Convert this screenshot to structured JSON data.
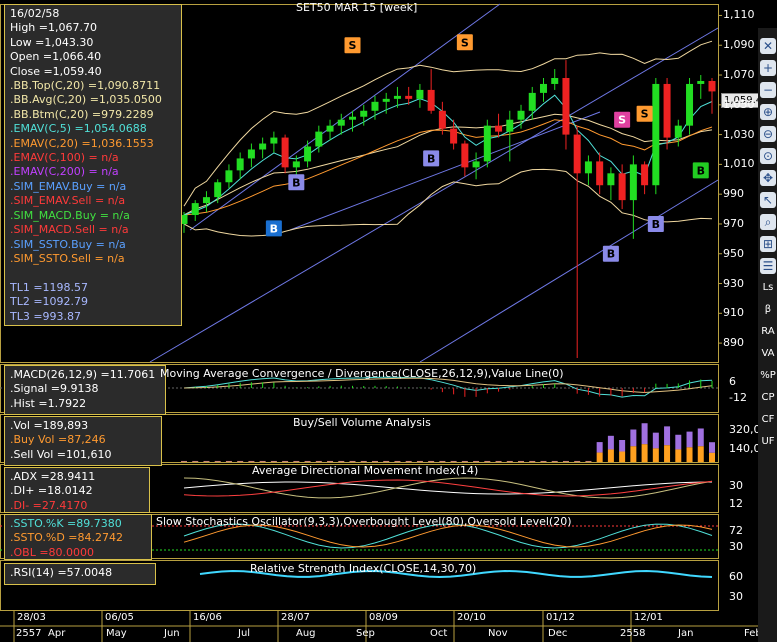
{
  "window": {
    "title": "SET50 MAR 15   [week]"
  },
  "info_main": [
    {
      "text": "16/02/58",
      "color": "#ffffff"
    },
    {
      "text": "High  =1,067.70",
      "color": "#ffffff"
    },
    {
      "text": "Low  =1,043.30",
      "color": "#ffffff"
    },
    {
      "text": "Open  =1,066.40",
      "color": "#ffffff"
    },
    {
      "text": "Close  =1,059.40",
      "color": "#ffffff"
    },
    {
      "text": ".BB.Top(C,20)  =1,090.8711",
      "color": "#f2e7a8"
    },
    {
      "text": ".BB.Avg(C,20)  =1,035.0500",
      "color": "#f2e7a8"
    },
    {
      "text": ".BB.Btm(C,20)  =979.2289",
      "color": "#f2e7a8"
    },
    {
      "text": ".EMAV(C,5)  =1,054.0688",
      "color": "#50e0d8"
    },
    {
      "text": ".EMAV(C,20)  =1,036.1553",
      "color": "#ff9a30"
    },
    {
      "text": ".EMAV(C,100)  = n/a",
      "color": "#ff3a3a"
    },
    {
      "text": ".EMAV(C,200)  = n/a",
      "color": "#c040ff"
    },
    {
      "text": ".SIM_EMAV.Buy  = n/a",
      "color": "#5aa0ff"
    },
    {
      "text": ".SIM_EMAV.Sell  = n/a",
      "color": "#ff3a3a"
    },
    {
      "text": ".SIM_MACD.Buy  = n/a",
      "color": "#40e040"
    },
    {
      "text": ".SIM_MACD.Sell  = n/a",
      "color": "#ff3a3a"
    },
    {
      "text": ".SIM_SSTO.Buy  = n/a",
      "color": "#5aa0ff"
    },
    {
      "text": ".SIM_SSTO.Sell  = n/a",
      "color": "#ff9a30"
    },
    {
      "text": "",
      "color": "#ffffff"
    },
    {
      "text": "TL1 =1198.57",
      "color": "#a8b8ff"
    },
    {
      "text": "TL2 =1092.79",
      "color": "#a8b8ff"
    },
    {
      "text": "TL3 =993.87",
      "color": "#a8b8ff"
    }
  ],
  "info_macd": [
    {
      "text": ".MACD(26,12,9)  =11.7061",
      "color": "#ffffff"
    },
    {
      "text": ".Signal  =9.9138",
      "color": "#ffffff"
    },
    {
      "text": ".Hist  =1.7922",
      "color": "#ffffff"
    }
  ],
  "info_vol": [
    {
      "text": ".Vol  =189,893",
      "color": "#ffffff"
    },
    {
      "text": ".Buy Vol  =87,246",
      "color": "#ff9a30"
    },
    {
      "text": ".Sell Vol  =101,610",
      "color": "#ffffff"
    }
  ],
  "info_adx": [
    {
      "text": ".ADX  =28.9411",
      "color": "#ffffff"
    },
    {
      "text": ".DI+  =18.0142",
      "color": "#ffffff"
    },
    {
      "text": ".DI-  =27.4170",
      "color": "#ff3a3a"
    }
  ],
  "info_ssto": [
    {
      "text": ".SSTO.%K  =89.7380",
      "color": "#50e0d8"
    },
    {
      "text": ".SSTO.%D  =84.2742",
      "color": "#ff9a30"
    },
    {
      "text": ".OBL  =80.0000",
      "color": "#ff3a3a"
    }
  ],
  "info_rsi": [
    {
      "text": ".RSI(14)  =57.0048",
      "color": "#ffffff"
    }
  ],
  "panel_titles": {
    "macd": "Moving Average Convergence / Divergence(CLOSE,26,12,9),Value Line(0)",
    "vol": "Buy/Sell Volume Analysis",
    "adx": "Average Directional Movement Index(14)",
    "ssto": "Slow Stochastics Oscillator(9,3,3),Overbought Level(80),Oversold Level(20)",
    "rsi": "Relative Strength Index(CLOSE,14,30,70)"
  },
  "last_price_label": "1,059.4",
  "toolbar": {
    "pin_icon": "pin-icon",
    "icons": [
      "close-icon",
      "plus-icon",
      "minus-icon",
      "zoom-in-icon",
      "zoom-out-icon",
      "zoom-fit-icon",
      "move-icon",
      "cursor-icon",
      "search-icon",
      "zoom-area-icon",
      "list-icon"
    ],
    "labels": [
      "Ls",
      "β",
      "RA",
      "VA",
      "%P",
      "CP",
      "CF",
      "UF"
    ]
  },
  "chart_data": [
    {
      "type": "candlestick",
      "title": "SET50 MAR 15   [week]",
      "y_ticks": [
        "1,110",
        "1,090",
        "1,070",
        "1,050",
        "1,030",
        "1,010",
        "990",
        "970",
        "950",
        "930",
        "910",
        "890"
      ],
      "ylim": [
        880,
        1115
      ],
      "x_top_labels": [
        "28/03",
        "06/05",
        "16/06",
        "28/07",
        "08/09",
        "20/10",
        "01/12",
        "12/01"
      ],
      "x_month_labels": [
        "2557",
        "Apr",
        "May",
        "Jun",
        "Jul",
        "Aug",
        "Sep",
        "Oct",
        "Nov",
        "Dec",
        "2558",
        "Jan",
        "Feb"
      ],
      "candles": [
        {
          "o": 970,
          "h": 978,
          "l": 964,
          "c": 976
        },
        {
          "o": 976,
          "h": 986,
          "l": 972,
          "c": 984
        },
        {
          "o": 984,
          "h": 992,
          "l": 978,
          "c": 988
        },
        {
          "o": 988,
          "h": 1000,
          "l": 984,
          "c": 998
        },
        {
          "o": 998,
          "h": 1010,
          "l": 994,
          "c": 1006
        },
        {
          "o": 1006,
          "h": 1018,
          "l": 1000,
          "c": 1014
        },
        {
          "o": 1014,
          "h": 1024,
          "l": 1008,
          "c": 1020
        },
        {
          "o": 1020,
          "h": 1028,
          "l": 1014,
          "c": 1024
        },
        {
          "o": 1024,
          "h": 1032,
          "l": 1018,
          "c": 1028
        },
        {
          "o": 1028,
          "h": 1030,
          "l": 1004,
          "c": 1008
        },
        {
          "o": 1008,
          "h": 1016,
          "l": 998,
          "c": 1012
        },
        {
          "o": 1012,
          "h": 1026,
          "l": 1008,
          "c": 1022
        },
        {
          "o": 1022,
          "h": 1036,
          "l": 1018,
          "c": 1032
        },
        {
          "o": 1032,
          "h": 1040,
          "l": 1026,
          "c": 1036
        },
        {
          "o": 1036,
          "h": 1044,
          "l": 1030,
          "c": 1040
        },
        {
          "o": 1040,
          "h": 1046,
          "l": 1032,
          "c": 1042
        },
        {
          "o": 1042,
          "h": 1050,
          "l": 1036,
          "c": 1046
        },
        {
          "o": 1046,
          "h": 1056,
          "l": 1040,
          "c": 1052
        },
        {
          "o": 1052,
          "h": 1058,
          "l": 1044,
          "c": 1054
        },
        {
          "o": 1054,
          "h": 1062,
          "l": 1048,
          "c": 1056
        },
        {
          "o": 1056,
          "h": 1062,
          "l": 1050,
          "c": 1054
        },
        {
          "o": 1054,
          "h": 1064,
          "l": 1048,
          "c": 1060
        },
        {
          "o": 1060,
          "h": 1074,
          "l": 1044,
          "c": 1046
        },
        {
          "o": 1046,
          "h": 1052,
          "l": 1030,
          "c": 1034
        },
        {
          "o": 1034,
          "h": 1040,
          "l": 1020,
          "c": 1024
        },
        {
          "o": 1024,
          "h": 1026,
          "l": 1002,
          "c": 1008
        },
        {
          "o": 1008,
          "h": 1018,
          "l": 1000,
          "c": 1012
        },
        {
          "o": 1012,
          "h": 1040,
          "l": 1008,
          "c": 1036
        },
        {
          "o": 1036,
          "h": 1044,
          "l": 1028,
          "c": 1032
        },
        {
          "o": 1032,
          "h": 1046,
          "l": 1012,
          "c": 1040
        },
        {
          "o": 1040,
          "h": 1050,
          "l": 1034,
          "c": 1046
        },
        {
          "o": 1046,
          "h": 1062,
          "l": 1040,
          "c": 1058
        },
        {
          "o": 1058,
          "h": 1068,
          "l": 1052,
          "c": 1064
        },
        {
          "o": 1064,
          "h": 1074,
          "l": 1060,
          "c": 1068
        },
        {
          "o": 1068,
          "h": 1080,
          "l": 1020,
          "c": 1030
        },
        {
          "o": 1030,
          "h": 1036,
          "l": 880,
          "c": 1004
        },
        {
          "o": 1004,
          "h": 1016,
          "l": 996,
          "c": 1012
        },
        {
          "o": 1012,
          "h": 1018,
          "l": 990,
          "c": 996
        },
        {
          "o": 996,
          "h": 1008,
          "l": 986,
          "c": 1004
        },
        {
          "o": 1004,
          "h": 1010,
          "l": 980,
          "c": 986
        },
        {
          "o": 986,
          "h": 1016,
          "l": 960,
          "c": 1010
        },
        {
          "o": 1010,
          "h": 1012,
          "l": 990,
          "c": 996
        },
        {
          "o": 996,
          "h": 1068,
          "l": 990,
          "c": 1064
        },
        {
          "o": 1064,
          "h": 1068,
          "l": 1020,
          "c": 1028
        },
        {
          "o": 1028,
          "h": 1040,
          "l": 1022,
          "c": 1036
        },
        {
          "o": 1036,
          "h": 1068,
          "l": 1030,
          "c": 1064
        },
        {
          "o": 1064,
          "h": 1070,
          "l": 1054,
          "c": 1066
        },
        {
          "o": 1066,
          "h": 1068,
          "l": 1044,
          "c": 1059
        }
      ],
      "signals": [
        {
          "label": "S",
          "i": 15,
          "price": 1090,
          "side": "sell"
        },
        {
          "label": "S",
          "i": 25,
          "price": 1092,
          "side": "sell"
        },
        {
          "label": "S",
          "i": 41,
          "price": 1044,
          "side": "sell"
        },
        {
          "label": "S",
          "i": 39,
          "price": 1040,
          "side": "sell2"
        },
        {
          "label": "B",
          "i": 8,
          "price": 967,
          "side": "buy2"
        },
        {
          "label": "B",
          "i": 10,
          "price": 998,
          "side": "buy"
        },
        {
          "label": "B",
          "i": 22,
          "price": 1014,
          "side": "buy"
        },
        {
          "label": "B",
          "i": 38,
          "price": 950,
          "side": "buy"
        },
        {
          "label": "B",
          "i": 42,
          "price": 970,
          "side": "buy"
        },
        {
          "label": "B",
          "i": 46,
          "price": 1006,
          "side": "buy3"
        }
      ]
    },
    {
      "type": "line",
      "title": "Moving Average Convergence / Divergence(CLOSE,26,12,9),Value Line(0)",
      "y_ticks": [
        "6",
        "-12"
      ]
    },
    {
      "type": "bar",
      "title": "Buy/Sell Volume Analysis",
      "y_ticks": [
        "320,0",
        "140,0"
      ],
      "ylim": [
        0,
        420000
      ],
      "buy": [
        5000,
        5000,
        5000,
        5000,
        5000,
        5000,
        5000,
        5000,
        5000,
        5000,
        5000,
        5000,
        5000,
        5000,
        5000,
        5000,
        5000,
        5000,
        5000,
        5000,
        5000,
        5000,
        5000,
        5000,
        5000,
        5000,
        5000,
        5000,
        5000,
        5000,
        5000,
        5000,
        5000,
        5000,
        5000,
        5000,
        5000,
        90000,
        120000,
        100000,
        150000,
        170000,
        130000,
        160000,
        120000,
        140000,
        150000,
        87246
      ],
      "sell": [
        5000,
        5000,
        5000,
        5000,
        5000,
        5000,
        5000,
        5000,
        5000,
        5000,
        5000,
        5000,
        5000,
        5000,
        5000,
        5000,
        5000,
        5000,
        5000,
        5000,
        5000,
        5000,
        5000,
        5000,
        5000,
        5000,
        5000,
        5000,
        5000,
        5000,
        5000,
        5000,
        5000,
        5000,
        5000,
        5000,
        5000,
        100000,
        130000,
        110000,
        160000,
        200000,
        150000,
        180000,
        140000,
        150000,
        170000,
        101610
      ]
    },
    {
      "type": "line",
      "title": "Average Directional Movement Index(14)",
      "y_ticks": [
        "30",
        "12"
      ]
    },
    {
      "type": "line",
      "title": "Slow Stochastics Oscillator(9,3,3),Overbought Level(80),Oversold Level(20)",
      "y_ticks": [
        "72",
        "30"
      ]
    },
    {
      "type": "line",
      "title": "Relative Strength Index(CLOSE,14,30,70)",
      "y_ticks": [
        "60",
        "30"
      ]
    }
  ]
}
